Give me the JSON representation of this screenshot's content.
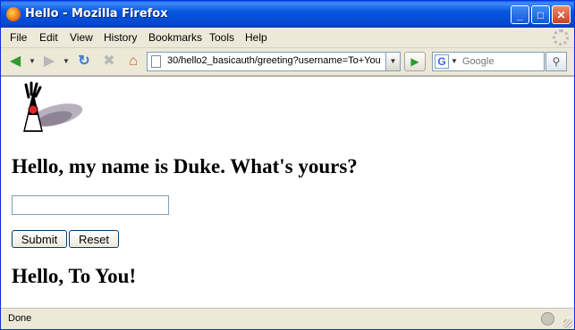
{
  "window": {
    "title": "Hello - Mozilla Firefox"
  },
  "titlebar": {
    "minimize": "_",
    "maximize": "□",
    "close": "✕"
  },
  "menu": {
    "items": [
      "File",
      "Edit",
      "View",
      "History",
      "Bookmarks",
      "Tools",
      "Help"
    ]
  },
  "nav": {
    "back_icon": "back-arrow-icon",
    "forward_icon": "forward-arrow-icon",
    "reload_icon": "reload-icon",
    "stop_icon": "stop-icon",
    "home_icon": "home-icon",
    "url": "30/hello2_basicauth/greeting?username=To+You",
    "search_engine": "G",
    "search_placeholder": "Google"
  },
  "page": {
    "heading": "Hello, my name is Duke. What's yours?",
    "input_value": "",
    "submit_label": "Submit",
    "reset_label": "Reset",
    "response": "Hello, To You!"
  },
  "status": {
    "text": "Done"
  },
  "colors": {
    "titlebar": "#0655e0",
    "chrome": "#ece9d8",
    "duke_nose": "#e0262a"
  }
}
